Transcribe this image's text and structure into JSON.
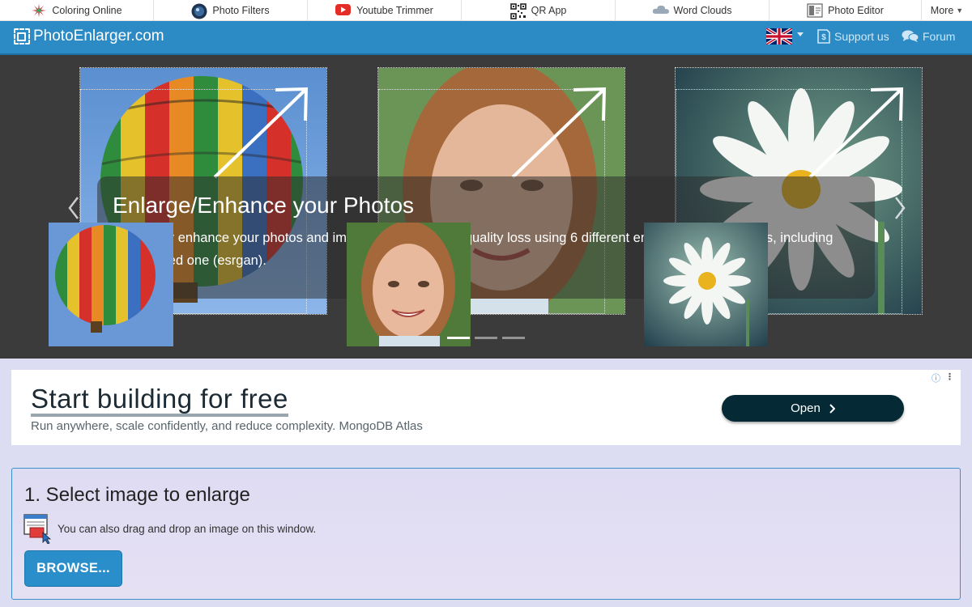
{
  "topbar": {
    "items": [
      {
        "label": "Coloring Online",
        "icon": "color-splash-icon"
      },
      {
        "label": "Photo Filters",
        "icon": "lens-icon"
      },
      {
        "label": "Youtube Trimmer",
        "icon": "youtube-icon"
      },
      {
        "label": "QR App",
        "icon": "qr-code-icon"
      },
      {
        "label": "Word Clouds",
        "icon": "cloud-icon"
      },
      {
        "label": "Photo Editor",
        "icon": "photo-editor-icon"
      },
      {
        "label": "More",
        "icon": "chevron-down-icon"
      }
    ]
  },
  "header": {
    "brand": "PhotoEnlarger.com",
    "language_flag": "uk-flag-icon",
    "support_label": "Support us",
    "forum_label": "Forum",
    "colors": {
      "background": "#2c8ac4",
      "link": "#cde7f7"
    }
  },
  "carousel": {
    "title": "Enlarge/Enhance your Photos",
    "description": "Enlarge or enhance your photos and images online without quality loss using 6 different enlargement algorithms, including an AI based one (esrgan).",
    "slides": [
      {
        "name": "hot-air-balloon"
      },
      {
        "name": "girl-portrait"
      },
      {
        "name": "daisy-flower"
      }
    ],
    "dots": [
      true,
      false,
      false
    ]
  },
  "ad": {
    "headline": "Start building for free",
    "subline": "Run anywhere, scale confidently, and reduce complexity. MongoDB Atlas",
    "cta": "Open",
    "info_icon": "ⓘ",
    "menu_icon": "⋮"
  },
  "step": {
    "title": "1. Select image to enlarge",
    "hint": "You can also drag and drop an image on this window.",
    "browse_label": "BROWSE..."
  }
}
